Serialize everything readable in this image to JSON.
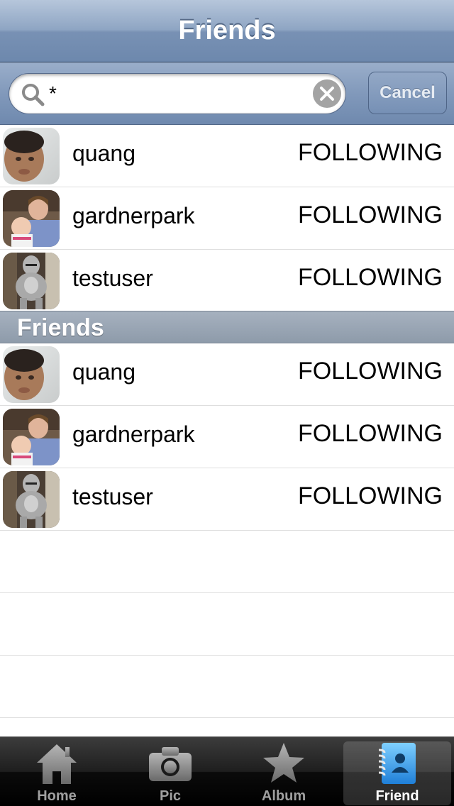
{
  "nav": {
    "title": "Friends"
  },
  "search": {
    "value": "*",
    "cancel_label": "Cancel"
  },
  "results": [
    {
      "name": "quang",
      "status": "FOLLOWING"
    },
    {
      "name": "gardnerpark",
      "status": "FOLLOWING"
    },
    {
      "name": "testuser",
      "status": "FOLLOWING"
    }
  ],
  "section": {
    "title": "Friends"
  },
  "friends": [
    {
      "name": "quang",
      "status": "FOLLOWING"
    },
    {
      "name": "gardnerpark",
      "status": "FOLLOWING"
    },
    {
      "name": "testuser",
      "status": "FOLLOWING"
    }
  ],
  "tabs": [
    {
      "label": "Home",
      "icon": "home-icon"
    },
    {
      "label": "Pic",
      "icon": "camera-icon"
    },
    {
      "label": "Album",
      "icon": "star-icon"
    },
    {
      "label": "Friend",
      "icon": "address-book-icon",
      "active": true
    }
  ],
  "colors": {
    "nav_blue": "#7891b4",
    "tab_active_blue": "#2f8fe0"
  }
}
